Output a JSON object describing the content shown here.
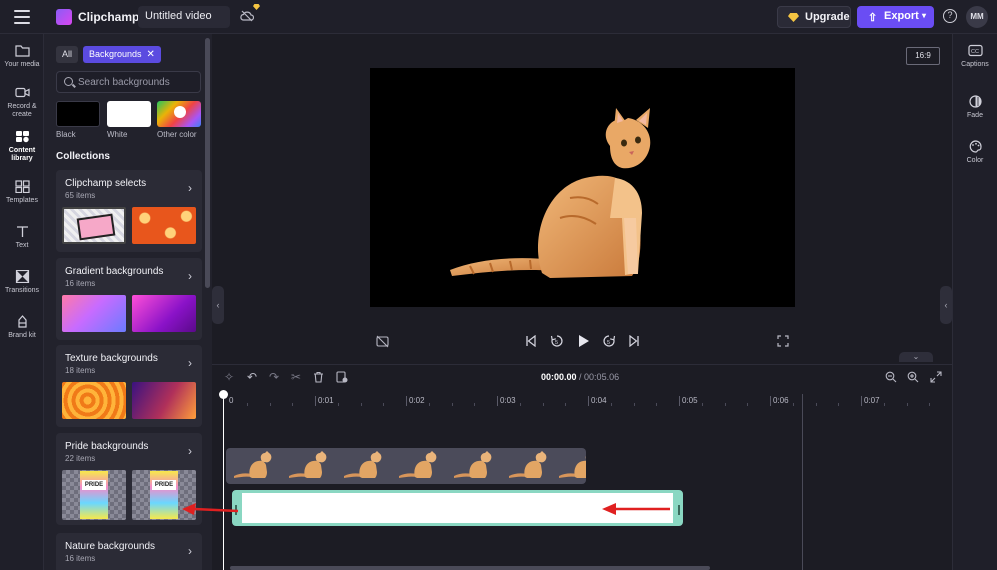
{
  "topbar": {
    "brand": "Clipchamp",
    "project_title": "Untitled video",
    "upgrade_label": "Upgrade",
    "export_label": "Export",
    "avatar_initials": "MM"
  },
  "leftrail": {
    "items": [
      {
        "label": "Your media",
        "icon": "folder-icon"
      },
      {
        "label": "Record & create",
        "icon": "camera-icon"
      },
      {
        "label": "Content library",
        "icon": "content-library-icon"
      },
      {
        "label": "Templates",
        "icon": "templates-icon"
      },
      {
        "label": "Text",
        "icon": "text-icon"
      },
      {
        "label": "Transitions",
        "icon": "transitions-icon"
      },
      {
        "label": "Brand kit",
        "icon": "brand-kit-icon"
      }
    ]
  },
  "panel": {
    "chip_all": "All",
    "chip_active": "Backgrounds",
    "search_placeholder": "Search backgrounds",
    "swatches": [
      {
        "label": "Black",
        "color": "#000000"
      },
      {
        "label": "White",
        "color": "#ffffff"
      },
      {
        "label": "Other color",
        "color": "gradient"
      }
    ],
    "collections_title": "Collections",
    "collections": [
      {
        "title": "Clipchamp selects",
        "count": "65 items"
      },
      {
        "title": "Gradient backgrounds",
        "count": "16 items"
      },
      {
        "title": "Texture backgrounds",
        "count": "18 items"
      },
      {
        "title": "Pride backgrounds",
        "count": "22 items"
      },
      {
        "title": "Nature backgrounds",
        "count": "16 items"
      }
    ],
    "pride_thumb_text": "PRIDE"
  },
  "rightrail": {
    "items": [
      {
        "label": "Captions",
        "icon": "captions-icon"
      },
      {
        "label": "Fade",
        "icon": "fade-icon"
      },
      {
        "label": "Color",
        "icon": "color-icon"
      }
    ]
  },
  "preview": {
    "aspect_ratio": "16:9"
  },
  "timeline": {
    "current_time": "00:00.00",
    "separator": " / ",
    "total_time": "00:05.06",
    "ticks": [
      "0",
      "0:01",
      "0:02",
      "0:03",
      "0:04",
      "0:05",
      "0:06",
      "0:07"
    ]
  },
  "annotations": {
    "arrow_color": "#e02020"
  }
}
